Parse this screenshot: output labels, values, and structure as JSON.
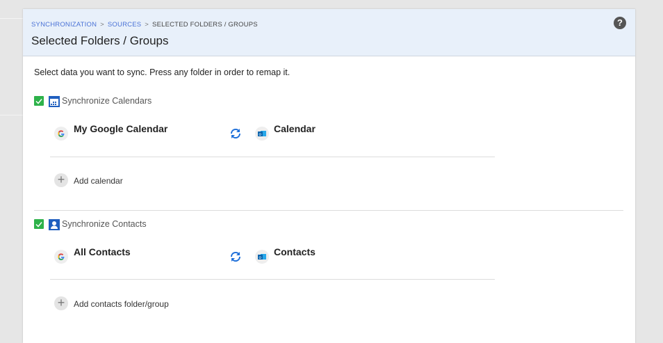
{
  "breadcrumb": {
    "items": [
      "SYNCHRONIZATION",
      "SOURCES"
    ],
    "current": "SELECTED FOLDERS / GROUPS",
    "separator": ">"
  },
  "page_title": "Selected Folders / Groups",
  "help_icon": "?",
  "intro": "Select data you want to sync. Press any folder in order to remap it.",
  "colors": {
    "accent": "#4a72d6",
    "check": "#2eb24a",
    "header_bg": "#e8f0fa"
  },
  "sections": [
    {
      "label": "Synchronize Calendars",
      "checked": true,
      "icon": "calendar-icon",
      "source": "My Google Calendar",
      "target": "Calendar",
      "add_label": "Add calendar"
    },
    {
      "label": "Synchronize Contacts",
      "checked": true,
      "icon": "contact-icon",
      "source": "All Contacts",
      "target": "Contacts",
      "add_label": "Add contacts folder/group"
    }
  ]
}
